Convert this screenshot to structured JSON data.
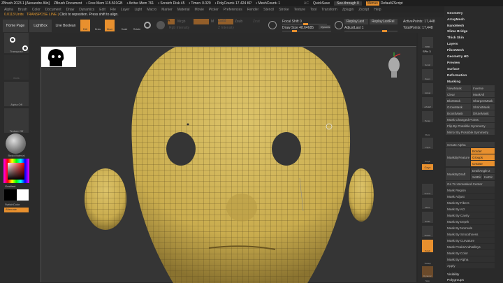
{
  "titlebar": {
    "app": "ZBrush 2023.1 [Alexandre Alin]",
    "doc": "ZBrush Document",
    "free_mem": "• Free Mem 115.501GB",
    "active_mem": "• Active Mem 761",
    "scratch": "• Scratch Disk 45",
    "timer": "• Timer• 0.029",
    "polycount": "• PolyCount• 17.424 KP",
    "meshcount": "• MeshCount• 1",
    "ac": "AC",
    "quicksave": "QuickSave",
    "seethrough": "See-through 0",
    "menus": "Menus",
    "defaultzscript": "DefaultZScript"
  },
  "menubar": [
    "Alpha",
    "Brush",
    "Color",
    "Document",
    "Draw",
    "Dynamics",
    "Edit",
    "File",
    "Layer",
    "Light",
    "Macro",
    "Marker",
    "Material",
    "Movie",
    "Picker",
    "Preferences",
    "Render",
    "Stencil",
    "Stroke",
    "Texture",
    "Tool",
    "Transform",
    "Zplugin",
    "Zscript",
    "Help"
  ],
  "status": {
    "units": "0.0113 Units",
    "mode": "TRANSPOSE LINE |",
    "hint": "Click to reposition. Press shift to align."
  },
  "toolbar": {
    "home": "Home Page",
    "lightbox": "LightBox",
    "liveboolean": "Live Boolean",
    "edit": "Edit",
    "draw": "Draw",
    "move": "Move",
    "scale": "Scale",
    "rotate": "Rotate",
    "a": "A",
    "mrgb": "Mrgb",
    "rgb": "Rgb",
    "m": "M",
    "zadd": "Zadd",
    "zsub": "Zsub",
    "zcut": "Zcut",
    "rgb_intensity": "Rgb Intensity",
    "z_intensity": "Z Intensity",
    "focal_shift": "Focal Shift 0",
    "draw_size": "Draw Size 48.64685",
    "dynamic": "Dynamic",
    "replaylast": "ReplayLast",
    "replaylastrel": "ReplayLastRel",
    "adjustlast": "AdjustLast 1",
    "activepoints": "ActivePoints: 17,448",
    "totalpoints": "TotalPoints: 17,448"
  },
  "leftshelf": {
    "transpose": "Transpose",
    "dots": "Dots",
    "alpha": "Alpha Off",
    "texture": "Texture Off",
    "material": "BasicMaterial",
    "gradient": "Gradient",
    "switchcolor": "SwitchColor",
    "alternate": "Alternate"
  },
  "rightshelf": [
    "BPR",
    "SPix 3",
    "Scroll",
    "Zoom",
    "Actual",
    "AAHalf",
    "Persp",
    "Floor",
    "L.Sym",
    "PolyF",
    "Gxyz",
    "Frame",
    "Move",
    "Scale",
    "Rotate",
    "PolyF",
    "Transp",
    "Dynamic",
    "Solo",
    "Xpose"
  ],
  "rightpanel": {
    "menus": [
      "Geometry",
      "ArrayMesh",
      "NanoMesh",
      "Slime Bridge",
      "Thick Skin",
      "Layers",
      "FiberMesh",
      "Geometry HD",
      "Preview",
      "Surface",
      "Deformation",
      "Masking"
    ],
    "mask_buttons": [
      "ViewMask",
      "Inverse",
      "Clear",
      "MaskAll",
      "BlurMask",
      "SharpenMask",
      "GrowMask",
      "ShrinkMask",
      "BoostMask",
      "DiluteMask"
    ],
    "mask_changed": "Mask Changed Points",
    "flip": "Flip By Possible Symmetry",
    "mirror": "Mirror By Possible Symmetry",
    "create_alpha": "Create Alpha",
    "maskbyfeature": "MaskByFeature",
    "border": "Border",
    "groups": "Groups",
    "crease": "Crease",
    "maskbydraft": "MaskByDraft",
    "draftangle": "DraftAngle 2",
    "setdir": "SetDir",
    "invdir": "InvDir",
    "goto": "Go To Unmasked Center",
    "mask_list": [
      "Mask Region",
      "Mask Adjust",
      "Mask By Fibers",
      "Mask By AO",
      "Mask By Cavity",
      "Mask By Depth",
      "Mask By Normals",
      "Mask By Smoothness",
      "Mask By Curvature",
      "Mask PeaksAndValleys",
      "Mask By Color",
      "Mask By Alpha",
      "Apply"
    ],
    "bottom": [
      "Visibility",
      "Polygroups"
    ]
  },
  "colors": {
    "accent": "#e8902e",
    "mesh": "#d2b65a"
  }
}
